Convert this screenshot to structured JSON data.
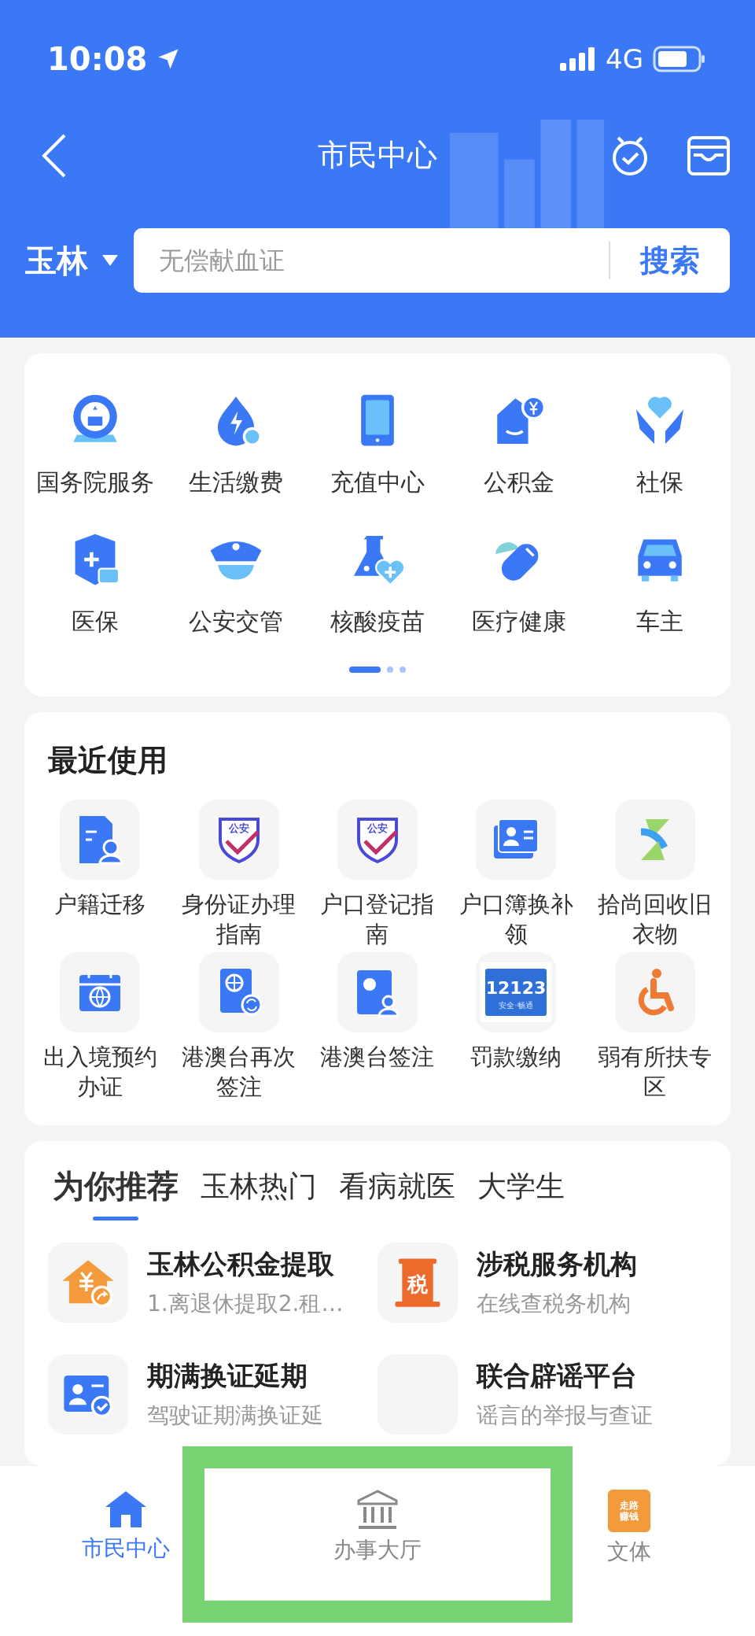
{
  "status_bar": {
    "time": "10:08",
    "network": "4G"
  },
  "header": {
    "title": "市民中心",
    "city": "玉林",
    "search": {
      "placeholder": "无偿献血证",
      "button": "搜索"
    }
  },
  "services": {
    "items": [
      {
        "label": "国务院服务",
        "kind": "emblem"
      },
      {
        "label": "生活缴费",
        "kind": "drop"
      },
      {
        "label": "充值中心",
        "kind": "tablet"
      },
      {
        "label": "公积金",
        "kind": "housecoin"
      },
      {
        "label": "社保",
        "kind": "hands"
      },
      {
        "label": "医保",
        "kind": "shieldcard"
      },
      {
        "label": "公安交管",
        "kind": "cap"
      },
      {
        "label": "核酸疫苗",
        "kind": "flask"
      },
      {
        "label": "医疗健康",
        "kind": "pill"
      },
      {
        "label": "车主",
        "kind": "car"
      }
    ],
    "pages": [
      {
        "selected": true
      },
      {
        "selected": false
      },
      {
        "selected": false
      }
    ]
  },
  "recent": {
    "title": "最近使用",
    "items": [
      {
        "label": "户籍迁移",
        "kind": "document"
      },
      {
        "label": "身份证办理指南",
        "kind": "shield",
        "badge": "公安"
      },
      {
        "label": "户口登记指南",
        "kind": "shield",
        "badge": "公安"
      },
      {
        "label": "户口簿换补领",
        "kind": "idcard"
      },
      {
        "label": "拾尚回收旧衣物",
        "kind": "slogo"
      },
      {
        "label": "出入境预约办证",
        "kind": "calendar"
      },
      {
        "label": "港澳台再次签注",
        "kind": "passport"
      },
      {
        "label": "港澳台签注",
        "kind": "permit"
      },
      {
        "label": "罚款缴纳",
        "kind": "plate",
        "badge": "12123",
        "badge_sub": "安全·畅通"
      },
      {
        "label": "弱有所扶专区",
        "kind": "wheelchair"
      }
    ]
  },
  "recommend": {
    "tabs": [
      {
        "label": "为你推荐",
        "selected": true
      },
      {
        "label": "玉林热门",
        "selected": false
      },
      {
        "label": "看病就医",
        "selected": false
      },
      {
        "label": "大学生",
        "selected": false
      }
    ],
    "items": [
      {
        "title": "玉林公积金提取",
        "subtitle": "1.离退休提取2.租…",
        "kind": "house"
      },
      {
        "title": "涉税服务机构",
        "subtitle": "在线查税务机构",
        "kind": "tax",
        "badge": "税"
      },
      {
        "title": "期满换证延期",
        "subtitle": "驾驶证期满换证延",
        "kind": "card"
      },
      {
        "title": "联合辟谣平台",
        "subtitle": "谣言的举报与查证",
        "kind": "blank"
      }
    ]
  },
  "tab_bar": [
    {
      "label": "市民中心",
      "selected": true,
      "framed": false,
      "kind": "home"
    },
    {
      "label": "办事大厅",
      "selected": false,
      "framed": true,
      "kind": "hall"
    },
    {
      "label": "文体",
      "selected": false,
      "framed": false,
      "kind": "badge",
      "badge": [
        "走路",
        "赚钱"
      ]
    }
  ]
}
